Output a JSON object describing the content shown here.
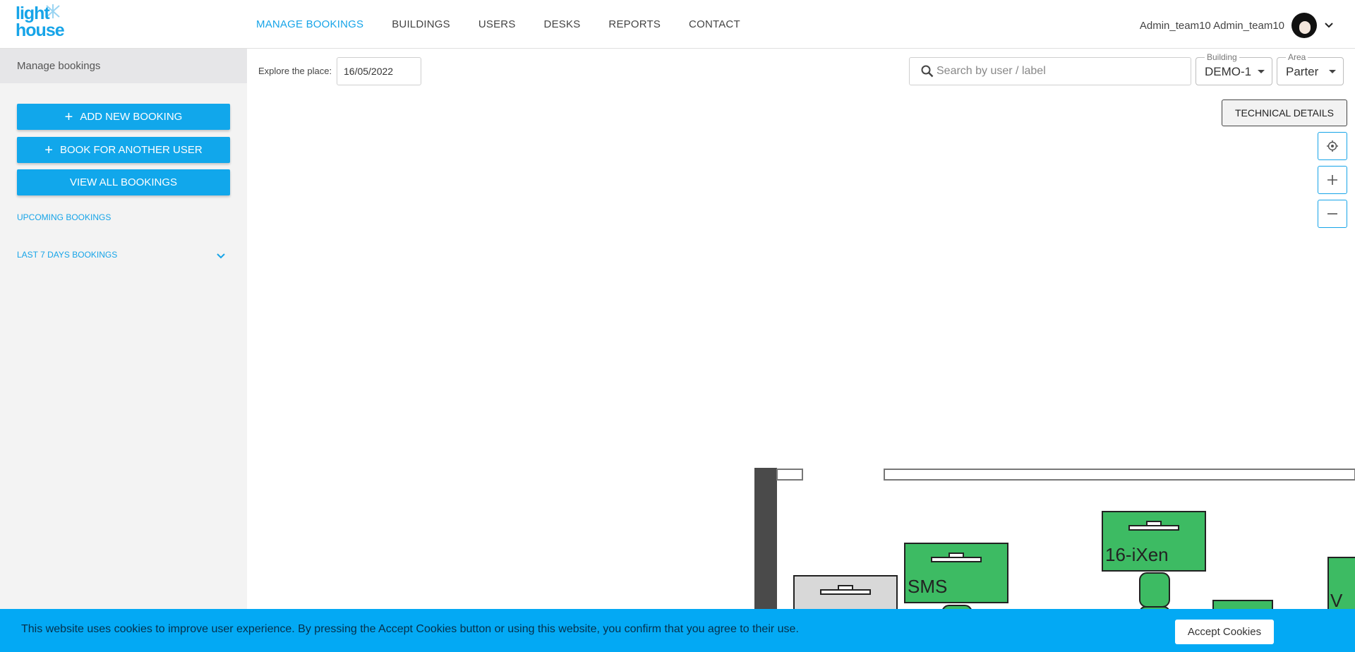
{
  "header": {
    "logo_line1": "light",
    "logo_line2": "house",
    "nav": [
      {
        "label": "MANAGE BOOKINGS",
        "active": true
      },
      {
        "label": "BUILDINGS"
      },
      {
        "label": "USERS"
      },
      {
        "label": "DESKS"
      },
      {
        "label": "REPORTS"
      },
      {
        "label": "CONTACT"
      }
    ],
    "user_name": "Admin_team10 Admin_team10",
    "accent_color": "#16a4e8"
  },
  "sidebar": {
    "title": "Manage bookings",
    "add_new_booking": "ADD NEW BOOKING",
    "book_for_another_user": "BOOK FOR ANOTHER USER",
    "view_all_bookings": "VIEW ALL BOOKINGS",
    "upcoming_bookings": "UPCOMING BOOKINGS",
    "last_7_days_bookings": "LAST 7 DAYS BOOKINGS"
  },
  "toolbar": {
    "explore_label": "Explore the place:",
    "date_value": "16/05/2022",
    "search_placeholder": "Search by user / label",
    "building_label": "Building",
    "building_value": "DEMO-1",
    "area_label": "Area",
    "area_value": "Parter",
    "technical_details": "TECHNICAL DETAILS"
  },
  "map": {
    "desks": [
      {
        "label": "SMS",
        "status": "available"
      },
      {
        "label": "16-iXen",
        "status": "available"
      },
      {
        "label": "V",
        "status": "available"
      }
    ],
    "available_color": "#3dbb63",
    "unavailable_color": "#d8d8d8"
  },
  "cookie": {
    "text": "This website uses cookies to improve user experience. By pressing the Accept Cookies button or using this website, you confirm that you agree to their use.",
    "accept": "Accept Cookies"
  }
}
